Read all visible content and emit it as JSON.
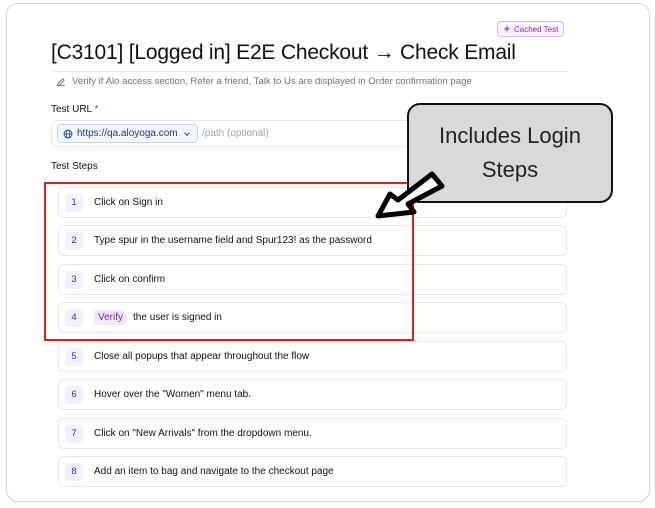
{
  "badge": {
    "label": "Cached Test",
    "icon": "bolt-icon"
  },
  "title": "[C3101] [Logged in] E2E Checkout → Check Email",
  "description": "Verify if Alo access section, Refer a friend, Talk to Us are displayed in Order confirmation page",
  "test_url": {
    "label": "Test URL",
    "required_mark": "*",
    "base_url": "https://qa.aloyoga.com",
    "path_placeholder": "/path (optional)",
    "path_value": ""
  },
  "test_steps": {
    "label": "Test Steps",
    "steps": [
      {
        "num": "1",
        "text": "Click on Sign in"
      },
      {
        "num": "2",
        "text": "Type spur in the username field and Spur123! as the password"
      },
      {
        "num": "3",
        "text": "Click on confirm"
      },
      {
        "num": "4",
        "tag": "Verify",
        "text": "the user is signed in"
      },
      {
        "num": "5",
        "text": "Close all popups that appear throughout the flow"
      },
      {
        "num": "6",
        "text": "Hover over the \"Women\" menu tab."
      },
      {
        "num": "7",
        "text": "Click on \"New Arrivals\" from the dropdown menu."
      },
      {
        "num": "8",
        "text": "Add an item to bag and navigate to the checkout page"
      }
    ]
  },
  "annotation": {
    "line1": "Includes Login",
    "line2": "Steps",
    "box_color": "#e11d1d"
  },
  "colors": {
    "accent_purple": "#7e22ce",
    "step_number_bg": "#eef2ff",
    "required": "#dc2626"
  }
}
